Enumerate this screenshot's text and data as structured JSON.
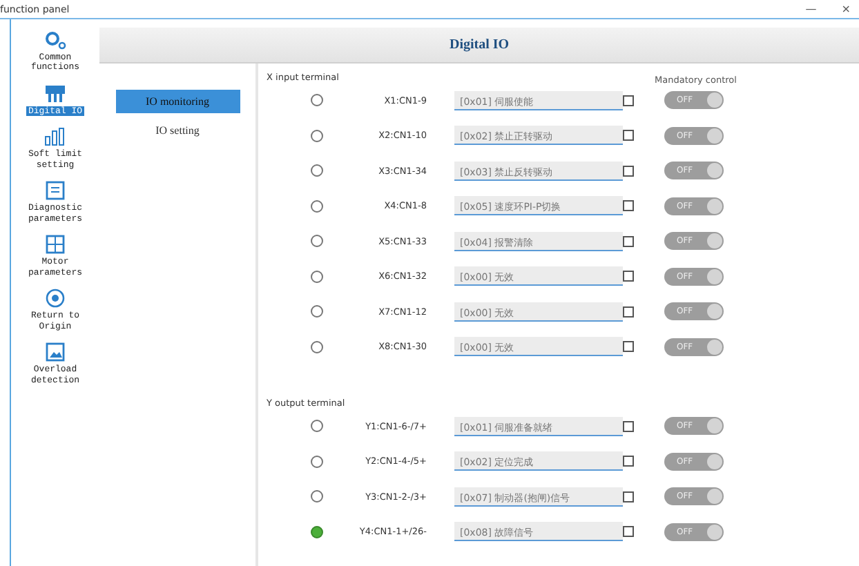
{
  "window": {
    "title": "function panel",
    "controls": [
      "—",
      "×"
    ]
  },
  "sidebar": {
    "items": [
      {
        "label": "Common functions",
        "selected": false
      },
      {
        "label": "Digital IO",
        "selected": true
      },
      {
        "label": "Soft limit setting",
        "selected": false
      },
      {
        "label": "Diagnostic parameters",
        "selected": false
      },
      {
        "label": "Motor parameters",
        "selected": false
      },
      {
        "label": "Return to Origin",
        "selected": false
      },
      {
        "label": "Overload detection",
        "selected": false
      }
    ]
  },
  "header": {
    "title": "Digital IO"
  },
  "subnav": [
    {
      "label": "IO monitoring",
      "selected": true
    },
    {
      "label": "IO setting",
      "selected": false
    }
  ],
  "mandatory_heading": "Mandatory control",
  "sections": [
    {
      "title": "X input terminal",
      "rows": [
        {
          "terminal": "X1:CN1-9",
          "function": "[0x01] 伺服使能",
          "on": false,
          "checked": false,
          "toggle": {
            "label": "OFF",
            "on": false
          }
        },
        {
          "terminal": "X2:CN1-10",
          "function": "[0x02] 禁止正转驱动",
          "on": false,
          "checked": false,
          "toggle": {
            "label": "OFF",
            "on": false
          }
        },
        {
          "terminal": "X3:CN1-34",
          "function": "[0x03] 禁止反转驱动",
          "on": false,
          "checked": false,
          "toggle": {
            "label": "OFF",
            "on": false
          }
        },
        {
          "terminal": "X4:CN1-8",
          "function": "[0x05] 速度环PI-P切换",
          "on": false,
          "checked": false,
          "toggle": {
            "label": "OFF",
            "on": false
          }
        },
        {
          "terminal": "X5:CN1-33",
          "function": "[0x04] 报警清除",
          "on": false,
          "checked": false,
          "toggle": {
            "label": "OFF",
            "on": false
          }
        },
        {
          "terminal": "X6:CN1-32",
          "function": "[0x00] 无效",
          "on": false,
          "checked": false,
          "toggle": {
            "label": "OFF",
            "on": false
          }
        },
        {
          "terminal": "X7:CN1-12",
          "function": "[0x00] 无效",
          "on": false,
          "checked": false,
          "toggle": {
            "label": "OFF",
            "on": false
          }
        },
        {
          "terminal": "X8:CN1-30",
          "function": "[0x00] 无效",
          "on": false,
          "checked": false,
          "toggle": {
            "label": "OFF",
            "on": false
          }
        }
      ]
    },
    {
      "title": "Y output terminal",
      "rows": [
        {
          "terminal": "Y1:CN1-6-/7+",
          "function": "[0x01] 伺服准备就绪",
          "on": false,
          "checked": false,
          "toggle": {
            "label": "OFF",
            "on": false
          }
        },
        {
          "terminal": "Y2:CN1-4-/5+",
          "function": "[0x02] 定位完成",
          "on": false,
          "checked": false,
          "toggle": {
            "label": "OFF",
            "on": false
          }
        },
        {
          "terminal": "Y3:CN1-2-/3+",
          "function": "[0x07] 制动器(抱闸)信号",
          "on": false,
          "checked": false,
          "toggle": {
            "label": "OFF",
            "on": false
          }
        },
        {
          "terminal": "Y4:CN1-1+/26-",
          "function": "[0x08] 故障信号",
          "on": true,
          "checked": false,
          "toggle": {
            "label": "OFF",
            "on": false
          }
        }
      ]
    }
  ]
}
